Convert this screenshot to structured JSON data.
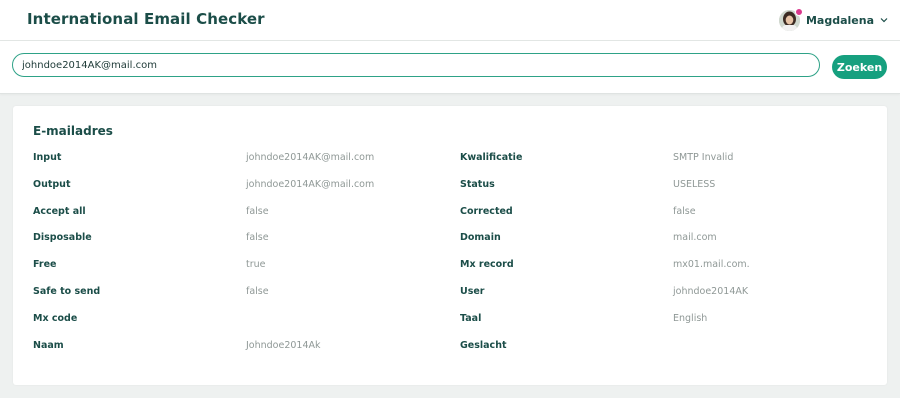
{
  "header": {
    "app_title": "International Email Checker",
    "user_name": "Magdalena",
    "user_icon": "avatar",
    "notification_color": "#d9388c",
    "menu_icon": "chevron-down-icon"
  },
  "search": {
    "value": "johndoe2014AK@mail.com",
    "button_label": "Zoeken",
    "accent_color": "#16a07f"
  },
  "result": {
    "title": "E-mailadres",
    "left_fields": [
      {
        "label": "Input",
        "value": "johndoe2014AK@mail.com"
      },
      {
        "label": "Output",
        "value": "johndoe2014AK@mail.com"
      },
      {
        "label": "Accept all",
        "value": "false"
      },
      {
        "label": "Disposable",
        "value": "false"
      },
      {
        "label": "Free",
        "value": "true"
      },
      {
        "label": "Safe to send",
        "value": "false"
      },
      {
        "label": "Mx code",
        "value": ""
      },
      {
        "label": "Naam",
        "value": "Johndoe2014Ak"
      }
    ],
    "right_fields": [
      {
        "label": "Kwalificatie",
        "value": "SMTP Invalid"
      },
      {
        "label": "Status",
        "value": "USELESS"
      },
      {
        "label": "Corrected",
        "value": "false"
      },
      {
        "label": "Domain",
        "value": "mail.com"
      },
      {
        "label": "Mx record",
        "value": "mx01.mail.com."
      },
      {
        "label": "User",
        "value": "johndoe2014AK"
      },
      {
        "label": "Taal",
        "value": "English"
      },
      {
        "label": "Geslacht",
        "value": ""
      }
    ]
  }
}
